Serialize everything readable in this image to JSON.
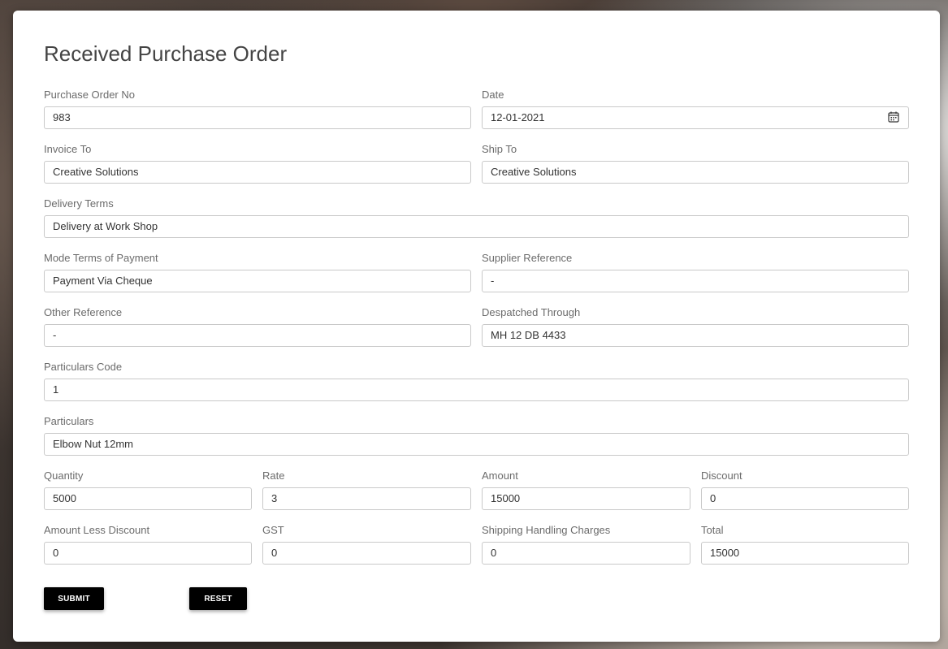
{
  "form": {
    "title": "Received Purchase Order",
    "purchase_order_no": {
      "label": "Purchase Order No",
      "value": "983"
    },
    "date": {
      "label": "Date",
      "value": "12-01-2021"
    },
    "invoice_to": {
      "label": "Invoice To",
      "value": "Creative Solutions"
    },
    "ship_to": {
      "label": "Ship To",
      "value": "Creative Solutions"
    },
    "delivery_terms": {
      "label": "Delivery Terms",
      "value": "Delivery at Work Shop"
    },
    "mode_terms_payment": {
      "label": "Mode Terms of Payment",
      "value": "Payment Via Cheque"
    },
    "supplier_reference": {
      "label": "Supplier Reference",
      "value": "-"
    },
    "other_reference": {
      "label": "Other Reference",
      "value": "-"
    },
    "despatched_through": {
      "label": "Despatched Through",
      "value": "MH 12 DB 4433"
    },
    "particulars_code": {
      "label": "Particulars Code",
      "value": "1"
    },
    "particulars": {
      "label": "Particulars",
      "value": "Elbow Nut 12mm"
    },
    "quantity": {
      "label": "Quantity",
      "value": "5000"
    },
    "rate": {
      "label": "Rate",
      "value": "3"
    },
    "amount": {
      "label": "Amount",
      "value": "15000"
    },
    "discount": {
      "label": "Discount",
      "value": "0"
    },
    "amount_less_discount": {
      "label": "Amount Less Discount",
      "value": "0"
    },
    "gst": {
      "label": "GST",
      "value": "0"
    },
    "shipping_handling": {
      "label": "Shipping Handling Charges",
      "value": "0"
    },
    "total": {
      "label": "Total",
      "value": "15000"
    },
    "submit_label": "SUBMIT",
    "reset_label": "RESET"
  },
  "icons": {
    "date_picker": "calendar-icon"
  }
}
